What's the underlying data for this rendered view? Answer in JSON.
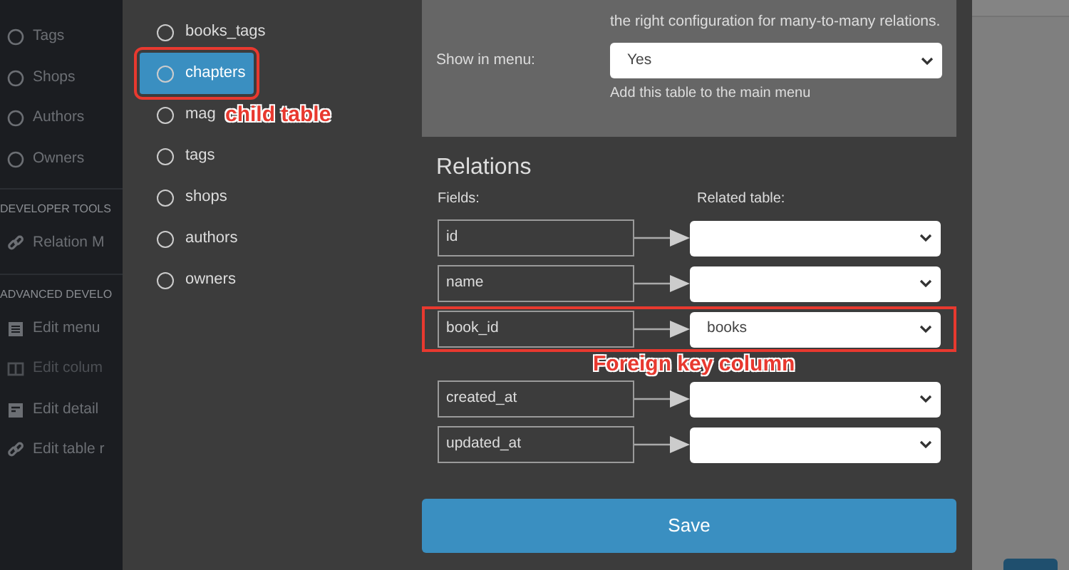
{
  "sidebar": {
    "items": [
      {
        "kind": "radio",
        "label": "Tags",
        "disabled": false
      },
      {
        "kind": "radio",
        "label": "Shops",
        "disabled": false
      },
      {
        "kind": "radio",
        "label": "Authors",
        "disabled": false
      },
      {
        "kind": "radio",
        "label": "Owners",
        "disabled": false
      },
      {
        "kind": "heading",
        "label": "DEVELOPER TOOLS"
      },
      {
        "kind": "link",
        "label": "Relation M",
        "disabled": false
      },
      {
        "kind": "heading",
        "label": "ADVANCED DEVELO"
      },
      {
        "kind": "menu",
        "label": "Edit menu",
        "disabled": false
      },
      {
        "kind": "columns",
        "label": "Edit colum",
        "disabled": true
      },
      {
        "kind": "detail",
        "label": "Edit detail",
        "disabled": false
      },
      {
        "kind": "link",
        "label": "Edit table r",
        "disabled": false
      }
    ]
  },
  "modal": {
    "tables": [
      {
        "label": "books_tags",
        "selected": false,
        "highlighted": false
      },
      {
        "label": "chapters",
        "selected": true,
        "highlighted": true
      },
      {
        "label": "mag",
        "selected": false,
        "highlighted": false
      },
      {
        "label": "tags",
        "selected": false,
        "highlighted": false
      },
      {
        "label": "shops",
        "selected": false,
        "highlighted": false
      },
      {
        "label": "authors",
        "selected": false,
        "highlighted": false
      },
      {
        "label": "owners",
        "selected": false,
        "highlighted": false
      }
    ],
    "settings": {
      "description": [
        "the right configuration for many-to-many relations."
      ],
      "show_in_menu": {
        "label": "Show in menu:",
        "value": "Yes",
        "help": "Add this table to the main menu"
      }
    },
    "relations": {
      "title": "Relations",
      "fields_label": "Fields:",
      "related_label": "Related table:",
      "rows": [
        {
          "field": "id",
          "related": "",
          "highlighted": false
        },
        {
          "field": "name",
          "related": "",
          "highlighted": false
        },
        {
          "field": "book_id",
          "related": "books",
          "highlighted": true
        },
        {
          "field": "created_at",
          "related": "",
          "highlighted": false
        },
        {
          "field": "updated_at",
          "related": "",
          "highlighted": false
        }
      ]
    },
    "save_button": "Save"
  },
  "annotations": [
    {
      "text": "child table"
    },
    {
      "text": "Foreign key column"
    }
  ]
}
